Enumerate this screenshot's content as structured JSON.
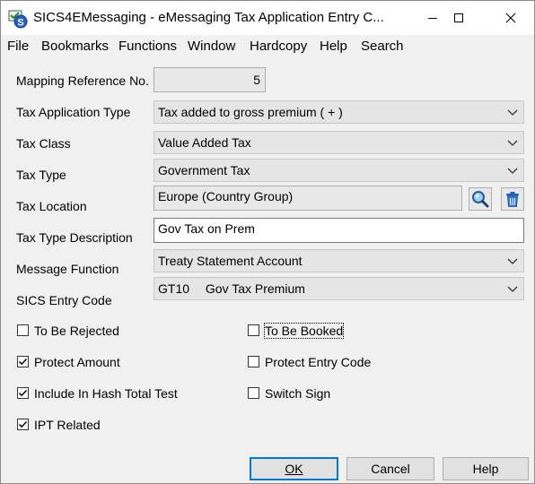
{
  "window": {
    "title": "SICS4EMessaging - eMessaging Tax Application Entry C..."
  },
  "menu": [
    "File",
    "Bookmarks",
    "Functions",
    "Window",
    "Hardcopy",
    "Help",
    "Search"
  ],
  "form": {
    "mapping_reference_no": {
      "label": "Mapping Reference No.",
      "value": "5"
    },
    "tax_application_type": {
      "label": "Tax Application Type",
      "value": "Tax added to gross premium ( + )"
    },
    "tax_class": {
      "label": "Tax Class",
      "value": "Value Added Tax"
    },
    "tax_type": {
      "label": "Tax Type",
      "value": "Government Tax"
    },
    "tax_location": {
      "label": "Tax Location",
      "value": "Europe (Country Group)"
    },
    "tax_type_description": {
      "label": "Tax Type Description",
      "value": "Gov Tax on Prem"
    },
    "message_function": {
      "label": "Message Function",
      "value": "Treaty Statement Account"
    },
    "sics_entry_code": {
      "label": "SICS Entry Code",
      "code": "GT10",
      "value": "Gov Tax Premium"
    }
  },
  "checkboxes": {
    "to_be_rejected": {
      "label": "To Be Rejected",
      "checked": false
    },
    "to_be_booked": {
      "label": "To Be Booked",
      "checked": false
    },
    "protect_amount": {
      "label": "Protect Amount",
      "checked": true
    },
    "protect_entry_code": {
      "label": "Protect Entry Code",
      "checked": false
    },
    "include_in_hash_total_test": {
      "label": "Include In Hash Total Test",
      "checked": true
    },
    "switch_sign": {
      "label": "Switch Sign",
      "checked": false
    },
    "ipt_related": {
      "label": "IPT Related",
      "checked": true
    }
  },
  "buttons": {
    "ok": "OK",
    "cancel": "Cancel",
    "help": "Help"
  },
  "colors": {
    "accent": "#0078d7",
    "field_bg": "#e5e5e5",
    "window_bg": "#f0f0f0"
  },
  "icons": [
    "app-icon",
    "minimize-icon",
    "maximize-icon",
    "close-icon",
    "search-icon",
    "trash-icon",
    "chevron-down-icon",
    "checkmark-icon"
  ]
}
